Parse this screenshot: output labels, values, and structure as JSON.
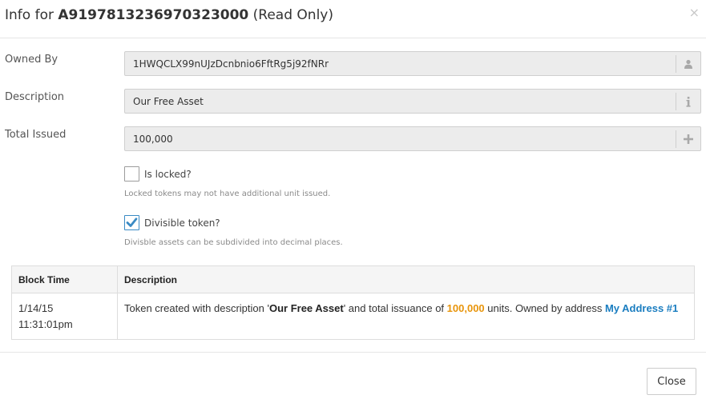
{
  "header": {
    "title_prefix": "Info for ",
    "asset_id": "A9197813236970323000",
    "title_suffix": " (Read Only)",
    "close_symbol": "×"
  },
  "fields": {
    "owned_by": {
      "label": "Owned By",
      "value": "1HWQCLX99nUJzDcnbnio6FftRg5j92fNRr",
      "icon": "user-icon"
    },
    "description": {
      "label": "Description",
      "value": "Our Free Asset",
      "icon": "info-icon"
    },
    "total_issued": {
      "label": "Total Issued",
      "value": "100,000",
      "icon": "plus-icon"
    }
  },
  "options": {
    "locked": {
      "label": "Is locked?",
      "checked": false,
      "help": "Locked tokens may not have additional unit issued."
    },
    "divisible": {
      "label": "Divisible token?",
      "checked": true,
      "help": "Divisble assets can be subdivided into decimal places."
    }
  },
  "history": {
    "columns": [
      "Block Time",
      "Description"
    ],
    "rows": [
      {
        "time_date": "1/14/15",
        "time_clock": "11:31:01pm",
        "desc_part1": "Token created with description '",
        "desc_name": "Our Free Asset",
        "desc_part2": "' and total issuance of ",
        "desc_amount": "100,000",
        "desc_part3": " units. Owned by address ",
        "desc_link": "My Address #1"
      }
    ]
  },
  "footer": {
    "close_label": "Close"
  },
  "colors": {
    "accent_orange": "#e8950c",
    "link_blue": "#1a7dc0",
    "check_blue": "#3a8ac4"
  }
}
